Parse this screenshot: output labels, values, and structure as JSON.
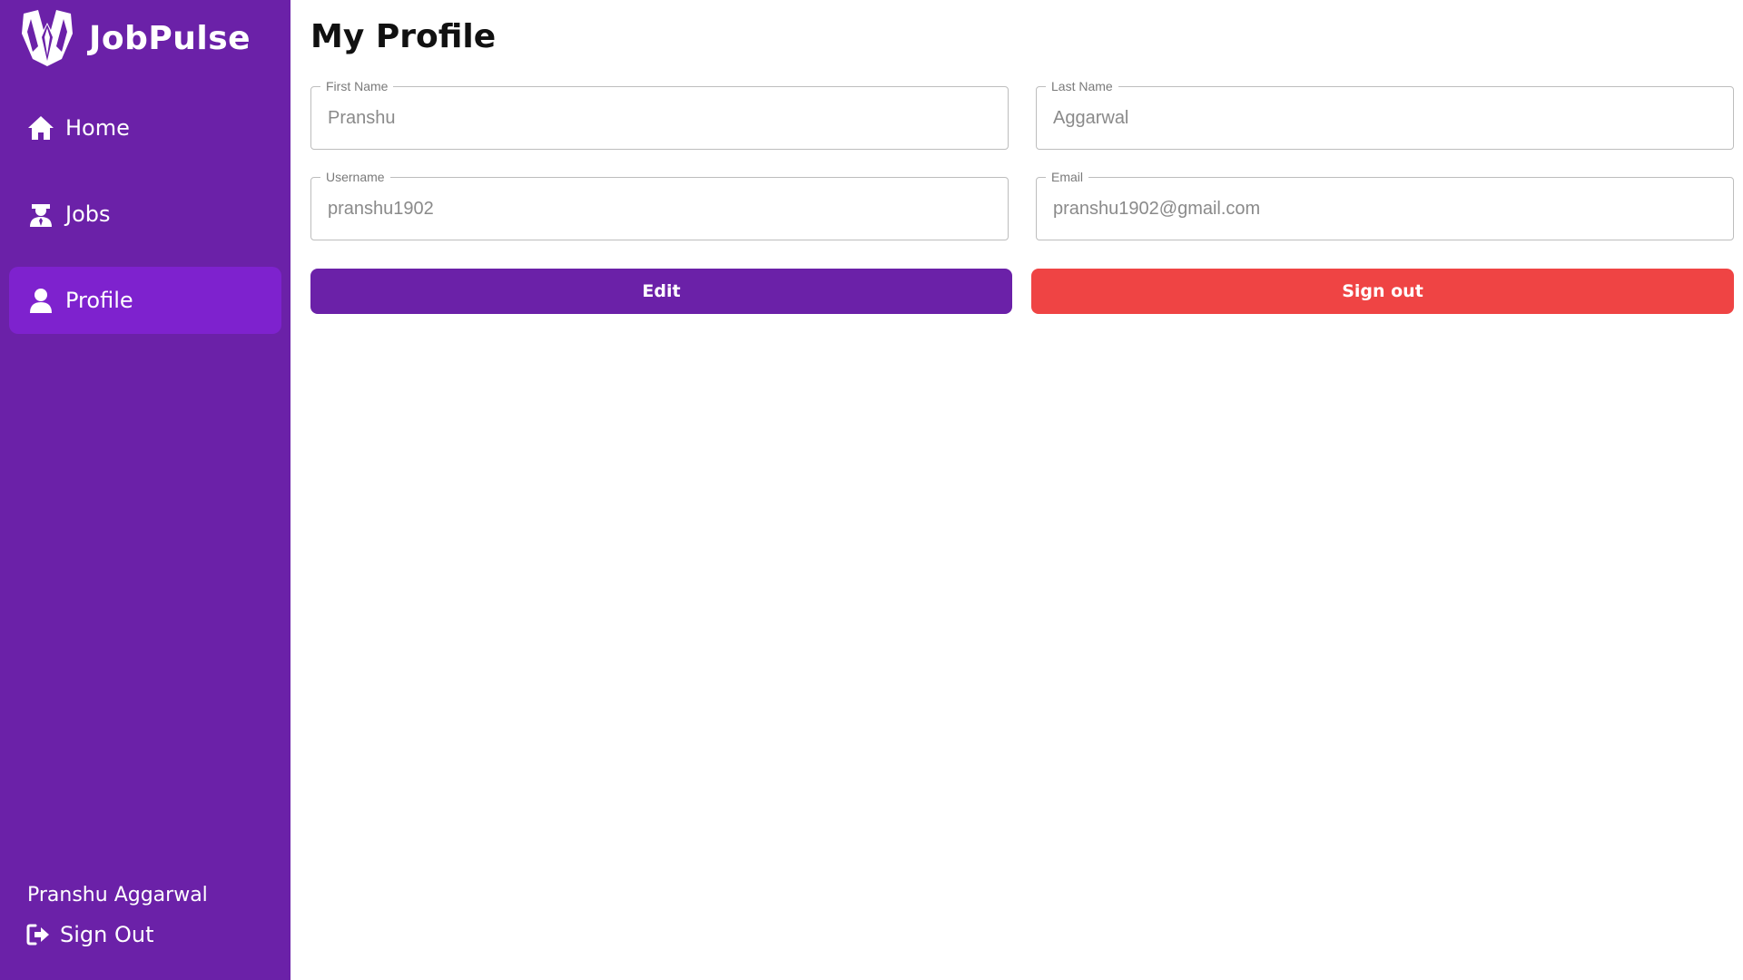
{
  "brand": {
    "name": "JobPulse",
    "logo_icon": "tuxedo-icon"
  },
  "sidebar": {
    "items": [
      {
        "label": "Home",
        "icon": "home-icon",
        "active": false
      },
      {
        "label": "Jobs",
        "icon": "user-tie-icon",
        "active": false
      },
      {
        "label": "Profile",
        "icon": "user-icon",
        "active": true
      }
    ],
    "user_name": "Pranshu Aggarwal",
    "signout_label": "Sign Out",
    "signout_icon": "sign-out-icon"
  },
  "page": {
    "title": "My Profile"
  },
  "form": {
    "first_name": {
      "label": "First Name",
      "value": "Pranshu"
    },
    "last_name": {
      "label": "Last Name",
      "value": "Aggarwal"
    },
    "username": {
      "label": "Username",
      "value": "pranshu1902"
    },
    "email": {
      "label": "Email",
      "value": "pranshu1902@gmail.com"
    }
  },
  "actions": {
    "edit_label": "Edit",
    "signout_label": "Sign out"
  },
  "colors": {
    "sidebar_bg": "#6b21a8",
    "active_item_bg": "#7e22ce",
    "edit_button": "#6b21a8",
    "signout_button": "#ef4444"
  }
}
